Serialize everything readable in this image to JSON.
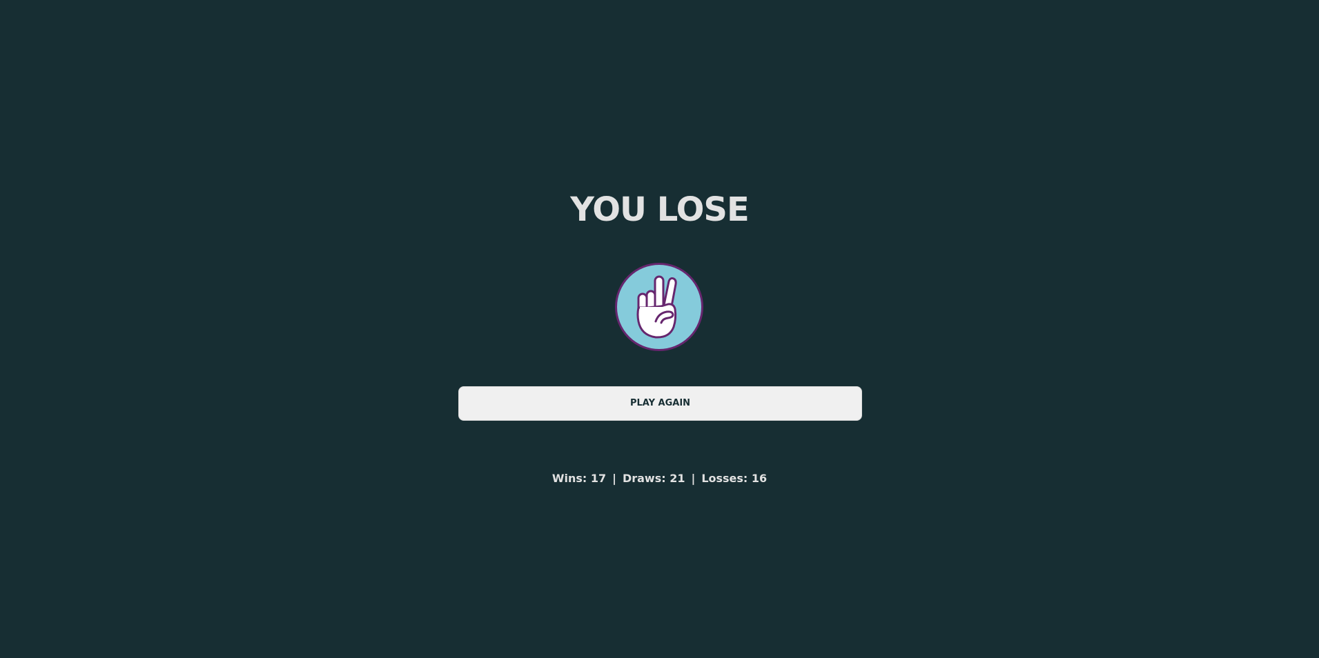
{
  "result": {
    "title": "YOU LOSE"
  },
  "choice": {
    "icon": "scissors-hand-icon",
    "circle_color": "#85cbdb",
    "ring_color": "#66266e"
  },
  "actions": {
    "play_again_label": "PLAY AGAIN"
  },
  "scoreboard": {
    "wins": "Wins: 17",
    "draws": "Draws: 21",
    "losses": "Losses: 16",
    "separator": "|"
  },
  "colors": {
    "background": "#172e33",
    "text": "#e2e2e2",
    "button_bg": "#f0f0f0"
  }
}
